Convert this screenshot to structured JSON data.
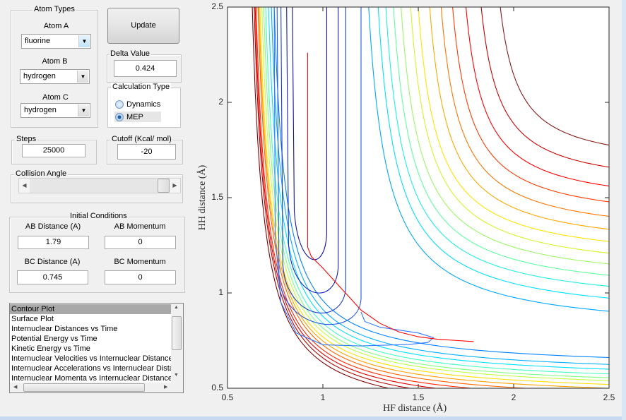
{
  "controls": {
    "atom_types": {
      "title": "Atom Types",
      "atom_a": {
        "label": "Atom A",
        "value": "fluorine"
      },
      "atom_b": {
        "label": "Atom B",
        "value": "hydrogen"
      },
      "atom_c": {
        "label": "Atom C",
        "value": "hydrogen"
      }
    },
    "update_label": "Update",
    "delta": {
      "title": "Delta Value",
      "value": "0.424"
    },
    "calc_type": {
      "title": "Calculation Type",
      "options": [
        "Dynamics",
        "MEP"
      ],
      "selected": "MEP"
    },
    "steps": {
      "title": "Steps",
      "value": "25000"
    },
    "cutoff": {
      "title": "Cutoff (Kcal/ mol)",
      "value": "-20"
    },
    "collision_angle": {
      "title": "Collision Angle",
      "value_fraction": 1.0
    },
    "initial_conditions": {
      "title": "Initial Conditions",
      "ab_distance": {
        "label": "AB Distance (A)",
        "value": "1.79"
      },
      "ab_momentum": {
        "label": "AB Momentum",
        "value": "0"
      },
      "bc_distance": {
        "label": "BC Distance (A)",
        "value": "0.745"
      },
      "bc_momentum": {
        "label": "BC Momentum",
        "value": "0"
      }
    },
    "plot_list": {
      "items": [
        "Contour Plot",
        "Surface Plot",
        "Internuclear Distances vs Time",
        "Potential Energy vs Time",
        "Kinetic Energy vs Time",
        "Internuclear Velocities vs Internuclear Distance",
        "Internuclear Accelerations vs Internuclear Distance",
        "Internuclear Momenta vs Internuclear Distance"
      ],
      "selected": "Contour Plot"
    }
  },
  "chart_data": {
    "type": "contour",
    "xlabel": "HF distance (Å)",
    "ylabel": "HH distance (Å)",
    "xlim": [
      0.5,
      2.5
    ],
    "ylim": [
      0.5,
      2.5
    ],
    "xticks": [
      "0.5",
      "1",
      "1.5",
      "2",
      "2.5"
    ],
    "yticks": [
      "0.5",
      "1",
      "1.5",
      "2",
      "2.5"
    ],
    "colormap": "jet",
    "upper_contours": [
      {
        "top_x": 1.93,
        "right_y": 1.776,
        "color": "#8b1a1a"
      },
      {
        "top_x": 1.83,
        "right_y": 1.66,
        "color": "#cc0000"
      },
      {
        "top_x": 1.75,
        "right_y": 1.561,
        "color": "#ff0000"
      },
      {
        "top_x": 1.68,
        "right_y": 1.478,
        "color": "#ff3a00"
      },
      {
        "top_x": 1.62,
        "right_y": 1.402,
        "color": "#ff7400"
      },
      {
        "top_x": 1.56,
        "right_y": 1.334,
        "color": "#ffa800"
      },
      {
        "top_x": 1.5,
        "right_y": 1.27,
        "color": "#ffe400"
      },
      {
        "top_x": 1.46,
        "right_y": 1.209,
        "color": "#d4f52c"
      },
      {
        "top_x": 1.41,
        "right_y": 1.152,
        "color": "#9cf766"
      },
      {
        "top_x": 1.37,
        "right_y": 1.093,
        "color": "#60ffa0"
      },
      {
        "top_x": 1.33,
        "right_y": 1.035,
        "color": "#20f0e0"
      },
      {
        "top_x": 1.29,
        "right_y": 0.973,
        "color": "#00e0ff"
      },
      {
        "top_x": 1.24,
        "right_y": 0.904,
        "color": "#00a8ff"
      }
    ],
    "lower_contours": [
      {
        "top_x": 0.63,
        "right_y": 0.4,
        "color": "#800000"
      },
      {
        "top_x": 0.64,
        "right_y": 0.42,
        "color": "#b00000"
      },
      {
        "top_x": 0.645,
        "right_y": 0.44,
        "color": "#e00000"
      },
      {
        "top_x": 0.65,
        "right_y": 0.46,
        "color": "#ff2800"
      },
      {
        "top_x": 0.66,
        "right_y": 0.48,
        "color": "#ff6400"
      },
      {
        "top_x": 0.665,
        "right_y": 0.5,
        "color": "#ffa000"
      },
      {
        "top_x": 0.67,
        "right_y": 0.52,
        "color": "#ffe000"
      },
      {
        "top_x": 0.68,
        "right_y": 0.54,
        "color": "#c0ff40"
      },
      {
        "top_x": 0.69,
        "right_y": 0.555,
        "color": "#80ff80"
      },
      {
        "top_x": 0.7,
        "right_y": 0.575,
        "color": "#40ffc0"
      },
      {
        "top_x": 0.715,
        "right_y": 0.6,
        "color": "#00e0ff"
      },
      {
        "top_x": 0.73,
        "right_y": 0.625,
        "color": "#00b0ff"
      },
      {
        "top_x": 0.745,
        "right_y": 0.661,
        "color": "#0080ff"
      }
    ],
    "valley_contours": [
      {
        "left_x": 0.84,
        "right_x": 1.02,
        "bottom_y": 1.13,
        "color": "#1010a0"
      },
      {
        "left_x": 0.81,
        "right_x": 1.08,
        "bottom_y": 0.955,
        "color": "#1020c0"
      },
      {
        "left_x": 0.78,
        "right_x": 1.12,
        "bottom_y": 0.85,
        "color": "#1a3ad8"
      },
      {
        "left_x": 0.76,
        "right_x": 1.2,
        "bottom_y": 0.79,
        "color": "#2058e8"
      }
    ],
    "trajectory": {
      "color": "#2f78ff",
      "points": [
        [
          0.745,
          2.5
        ],
        [
          0.75,
          1.3
        ],
        [
          0.78,
          0.95
        ],
        [
          0.86,
          0.79
        ],
        [
          1.0,
          0.728
        ],
        [
          1.2,
          0.722
        ],
        [
          1.45,
          0.73
        ],
        [
          1.55,
          0.74
        ],
        [
          1.58,
          0.765
        ],
        [
          1.5,
          0.79
        ],
        [
          1.3,
          0.82
        ],
        [
          1.22,
          0.85
        ],
        [
          1.2,
          0.9
        ]
      ]
    },
    "mep_path": {
      "color": "#ff0000",
      "points": [
        [
          0.92,
          2.26
        ],
        [
          0.92,
          1.24
        ],
        [
          0.94,
          1.19
        ],
        [
          1.0,
          1.13
        ],
        [
          1.1,
          1.02
        ],
        [
          1.2,
          0.91
        ],
        [
          1.3,
          0.84
        ],
        [
          1.4,
          0.795
        ],
        [
          1.5,
          0.77
        ],
        [
          1.6,
          0.757
        ],
        [
          1.79,
          0.745
        ]
      ]
    }
  }
}
